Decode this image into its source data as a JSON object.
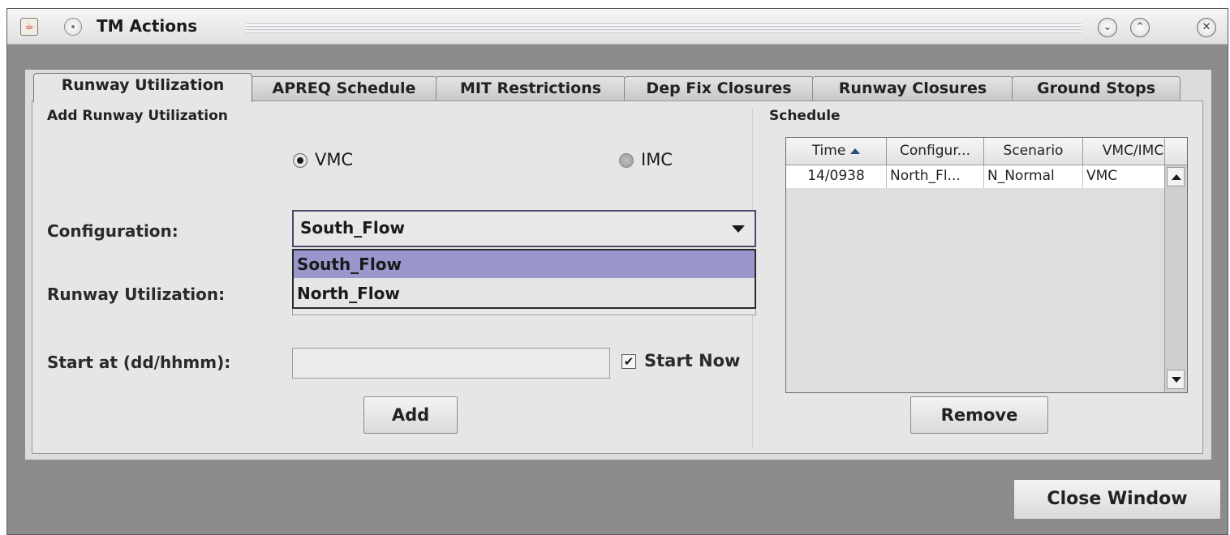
{
  "window": {
    "title": "TM Actions",
    "icons": {
      "app": "java-cup-icon",
      "menu": "window-menu-icon",
      "minimize": "minimize-icon",
      "maximize": "maximize-icon",
      "close": "close-icon"
    }
  },
  "tabs": [
    {
      "label": "Runway Utilization",
      "active": true
    },
    {
      "label": "APREQ Schedule",
      "active": false
    },
    {
      "label": "MIT Restrictions",
      "active": false
    },
    {
      "label": "Dep Fix Closures",
      "active": false
    },
    {
      "label": "Runway Closures",
      "active": false
    },
    {
      "label": "Ground Stops",
      "active": false
    }
  ],
  "add_panel": {
    "title": "Add Runway Utilization",
    "radio_vmc": {
      "label": "VMC",
      "selected": true
    },
    "radio_imc": {
      "label": "IMC",
      "selected": false
    },
    "configuration_label": "Configuration:",
    "configuration_value": "South_Flow",
    "configuration_options": [
      "South_Flow",
      "North_Flow"
    ],
    "runway_utilization_label": "Runway Utilization:",
    "start_at_label": "Start at (dd/hhmm):",
    "start_at_value": "",
    "start_now_label": "Start Now",
    "start_now_checked": true,
    "add_button": "Add"
  },
  "schedule": {
    "title": "Schedule",
    "columns": [
      "Time",
      "Configur...",
      "Scenario",
      "VMC/IMC"
    ],
    "rows": [
      [
        "14/0938",
        "North_Fl...",
        "N_Normal",
        "VMC"
      ]
    ],
    "remove_button": "Remove"
  },
  "footer": {
    "close_button": "Close Window"
  },
  "colors": {
    "dropdown_selected": "#9a97cc",
    "window_bg": "#8c8c8c",
    "panel_bg": "#e6e6e6"
  }
}
